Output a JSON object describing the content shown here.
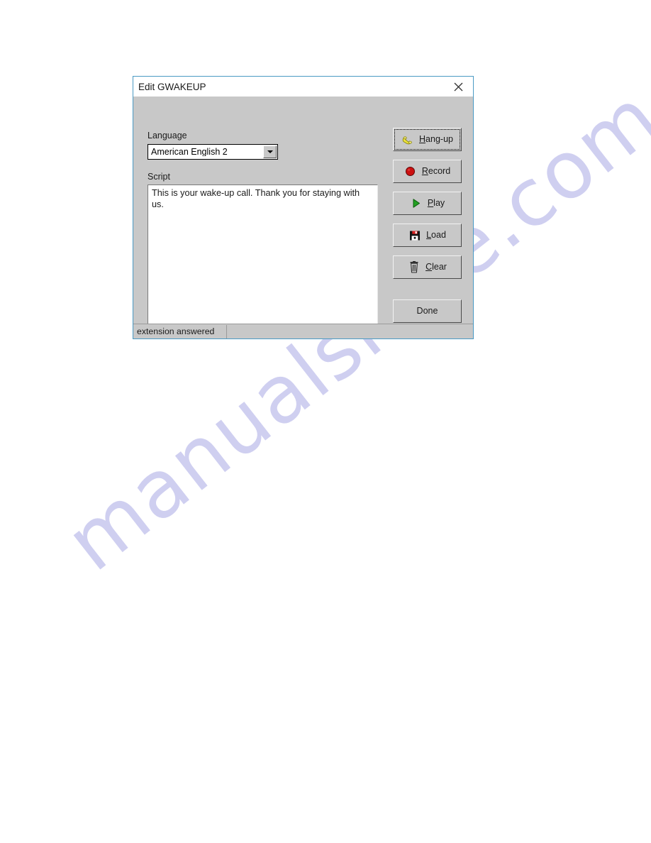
{
  "window": {
    "title": "Edit GWAKEUP",
    "close_icon": "close-icon",
    "border_color": "#4a9ac4",
    "face_color": "#c8c8c8"
  },
  "form": {
    "language": {
      "label": "Language",
      "value": "American English 2",
      "arrow_icon": "chevron-down-icon"
    },
    "script": {
      "label": "Script",
      "value": "This is your wake-up call. Thank you for staying with us.",
      "placeholder": ""
    }
  },
  "buttons": [
    {
      "id": "hangup",
      "label": "Hang-up",
      "accel": "H",
      "icon": "telephone-handset-icon",
      "focused": true
    },
    {
      "id": "record",
      "label": "Record",
      "accel": "R",
      "icon": "record-circle-icon",
      "focused": false
    },
    {
      "id": "play",
      "label": "Play",
      "accel": "P",
      "icon": "play-triangle-icon",
      "focused": false
    },
    {
      "id": "load",
      "label": "Load",
      "accel": "L",
      "icon": "floppy-disk-icon",
      "focused": false
    },
    {
      "id": "clear",
      "label": "Clear",
      "accel": "C",
      "icon": "trash-can-icon",
      "focused": false
    },
    {
      "id": "done",
      "label": "Done",
      "accel": "",
      "icon": "",
      "focused": false
    }
  ],
  "button_labels": {
    "hangup_pre": "",
    "hangup_accel": "H",
    "hangup_post": "ang-up",
    "record_pre": "",
    "record_accel": "R",
    "record_post": "ecord",
    "play_pre": "",
    "play_accel": "P",
    "play_post": "lay",
    "load_pre": "",
    "load_accel": "L",
    "load_post": "oad",
    "clear_pre": "",
    "clear_accel": "C",
    "clear_post": "lear",
    "done": "Done"
  },
  "statusbar": {
    "message": "extension answered"
  },
  "watermark": {
    "text": "manualshive.com",
    "color": "#c9c9ef"
  },
  "colors": {
    "accent_yellow": "#e8e03c",
    "record_red": "#cc1111",
    "play_green": "#1f9e23",
    "title_text": "#1a1a1a"
  }
}
